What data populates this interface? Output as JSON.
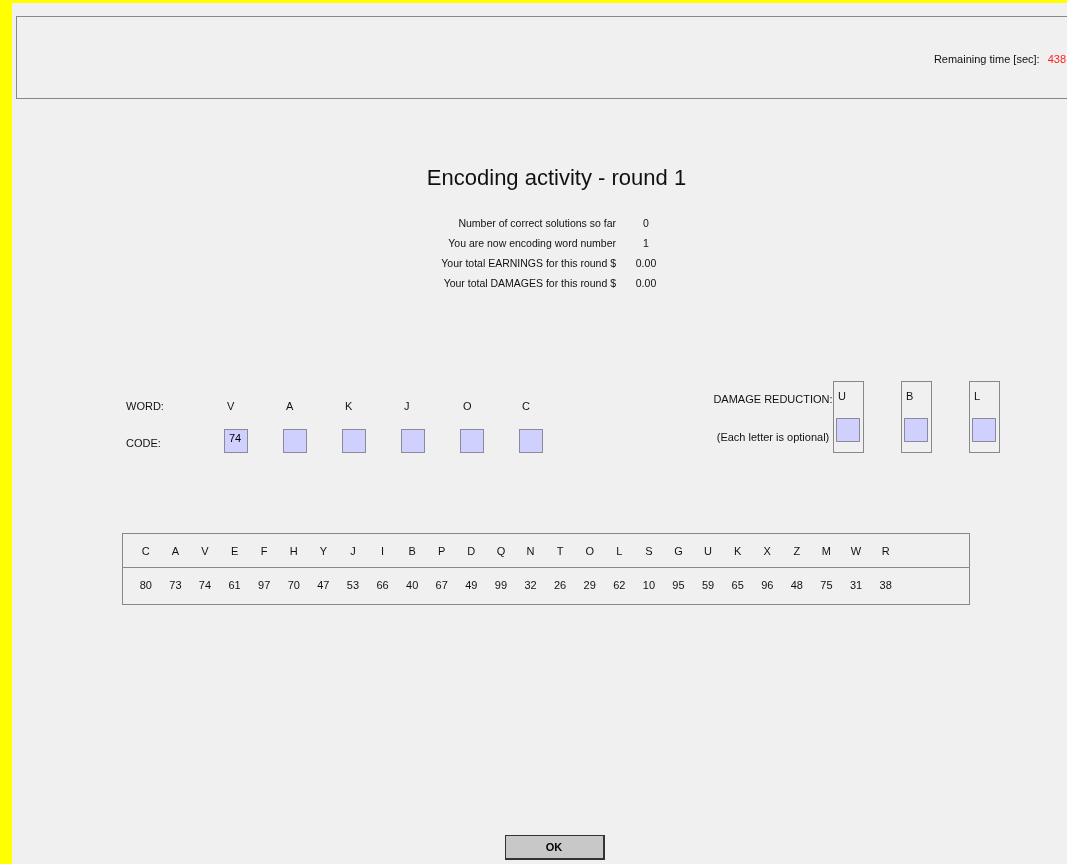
{
  "timer": {
    "label": "Remaining time [sec]:",
    "value": "438"
  },
  "title": "Encoding activity - round 1",
  "stats": [
    {
      "label": "Number of correct solutions so far",
      "value": "0"
    },
    {
      "label": "You are now encoding word number",
      "value": "1"
    },
    {
      "label": "Your total EARNINGS for this round $",
      "value": "0.00"
    },
    {
      "label": "Your total DAMAGES for this round $",
      "value": "0.00"
    }
  ],
  "word": {
    "word_label": "WORD:",
    "code_label": "CODE:",
    "letters": [
      {
        "letter": "V",
        "code": "74"
      },
      {
        "letter": "A"
      },
      {
        "letter": "K"
      },
      {
        "letter": "J"
      },
      {
        "letter": "O"
      },
      {
        "letter": "C"
      }
    ]
  },
  "damage_reduction": {
    "label": "DAMAGE REDUCTION:",
    "note": "(Each letter is optional)",
    "letters": [
      "U",
      "B",
      "L"
    ]
  },
  "key": [
    {
      "letter": "C",
      "code": "80"
    },
    {
      "letter": "A",
      "code": "73"
    },
    {
      "letter": "V",
      "code": "74"
    },
    {
      "letter": "E",
      "code": "61"
    },
    {
      "letter": "F",
      "code": "97"
    },
    {
      "letter": "H",
      "code": "70"
    },
    {
      "letter": "Y",
      "code": "47"
    },
    {
      "letter": "J",
      "code": "53"
    },
    {
      "letter": "I",
      "code": "66"
    },
    {
      "letter": "B",
      "code": "40"
    },
    {
      "letter": "P",
      "code": "67"
    },
    {
      "letter": "D",
      "code": "49"
    },
    {
      "letter": "Q",
      "code": "99"
    },
    {
      "letter": "N",
      "code": "32"
    },
    {
      "letter": "T",
      "code": "26"
    },
    {
      "letter": "O",
      "code": "29"
    },
    {
      "letter": "L",
      "code": "62"
    },
    {
      "letter": "S",
      "code": "10"
    },
    {
      "letter": "G",
      "code": "95"
    },
    {
      "letter": "U",
      "code": "59"
    },
    {
      "letter": "K",
      "code": "65"
    },
    {
      "letter": "X",
      "code": "96"
    },
    {
      "letter": "Z",
      "code": "48"
    },
    {
      "letter": "M",
      "code": "75"
    },
    {
      "letter": "W",
      "code": "31"
    },
    {
      "letter": "R",
      "code": "38"
    }
  ],
  "ok_button": "OK"
}
